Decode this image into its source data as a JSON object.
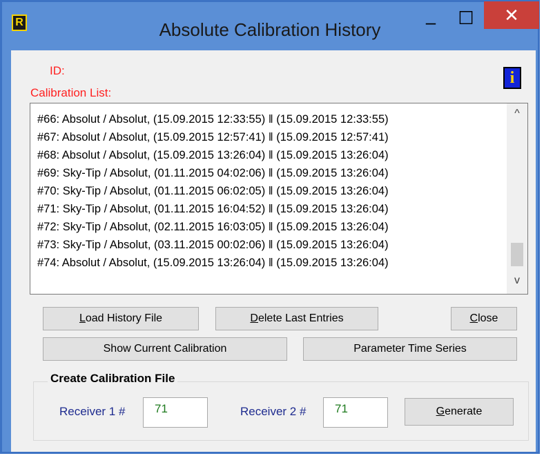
{
  "window": {
    "title": "Absolute Calibration History",
    "icon_glyph": "R",
    "controls": {
      "minimize": "–",
      "maximize": "☐",
      "close": "✕"
    },
    "title_color": "#5b8fd6",
    "close_color": "#c9403a"
  },
  "labels": {
    "id": "ID:",
    "calibration_list": "Calibration List:"
  },
  "info_icon": {
    "glyph": "i",
    "name": "info-icon"
  },
  "calibration_list": {
    "items": [
      "#66: Absolut / Absolut, (15.09.2015  12:33:55) ‖ (15.09.2015  12:33:55)",
      "#67: Absolut / Absolut, (15.09.2015  12:57:41) ‖ (15.09.2015  12:57:41)",
      "#68: Absolut / Absolut, (15.09.2015  13:26:04) ‖ (15.09.2015  13:26:04)",
      "#69: Sky-Tip / Absolut, (01.11.2015  04:02:06) ‖ (15.09.2015  13:26:04)",
      "#70: Sky-Tip / Absolut, (01.11.2015  06:02:05) ‖ (15.09.2015  13:26:04)",
      "#71: Sky-Tip / Absolut, (01.11.2015  16:04:52) ‖ (15.09.2015  13:26:04)",
      "#72: Sky-Tip / Absolut, (02.11.2015  16:03:05) ‖ (15.09.2015  13:26:04)",
      "#73: Sky-Tip / Absolut, (03.11.2015  00:02:06) ‖ (15.09.2015  13:26:04)",
      "#74: Absolut / Absolut, (15.09.2015  13:26:04) ‖ (15.09.2015  13:26:04)"
    ],
    "scroll_up": "^",
    "scroll_down": "v"
  },
  "buttons": {
    "load_history": {
      "accel": "L",
      "rest": "oad History File"
    },
    "delete_last": {
      "accel": "D",
      "rest": "elete Last Entries"
    },
    "close": {
      "accel": "C",
      "rest": "lose"
    },
    "show_current": "Show Current Calibration",
    "parameter_series": "Parameter Time Series",
    "generate": {
      "accel": "G",
      "rest": "enerate"
    }
  },
  "create_group": {
    "title": "Create Calibration File",
    "receiver1_label": "Receiver 1 #",
    "receiver1_value": "71",
    "receiver2_label": "Receiver 2 #",
    "receiver2_value": "71"
  }
}
